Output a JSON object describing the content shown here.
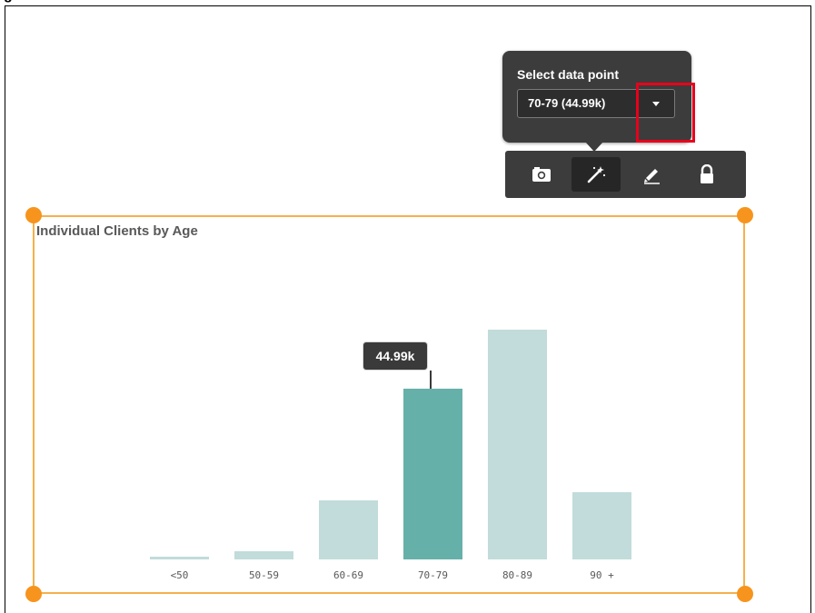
{
  "caption": "g",
  "popup": {
    "title": "Select data point",
    "selected_value": "70-79 (44.99k)"
  },
  "toolbar": {
    "items": [
      "camera-icon",
      "magic-wand-icon",
      "pencil-icon",
      "lock-icon"
    ],
    "active_item": "magic-wand-icon"
  },
  "colors": {
    "bar_highlight": "#66b0aa",
    "bar_default": "#c1dcda",
    "selection": "#f7941d",
    "highlight_box": "#e8001c"
  },
  "chart": {
    "title": "Individual Clients by Age",
    "tooltip": "44.99k"
  },
  "chart_data": {
    "type": "bar",
    "title": "Individual Clients by Age",
    "categories": [
      "<50",
      "50-59",
      "60-69",
      "70-79",
      "80-89",
      "90+"
    ],
    "tick_labels": [
      "<50",
      "50-59",
      "60-69",
      "70-79",
      "80-89",
      "90 +"
    ],
    "values": [
      0.6,
      2.2,
      15.4,
      44.99,
      60.4,
      17.7
    ],
    "highlighted_category": "70-79",
    "data_labels": [
      {
        "category": "70-79",
        "text": "44.99k"
      }
    ],
    "ylim": [
      0,
      60.4
    ],
    "grid": false,
    "legend": "none"
  }
}
